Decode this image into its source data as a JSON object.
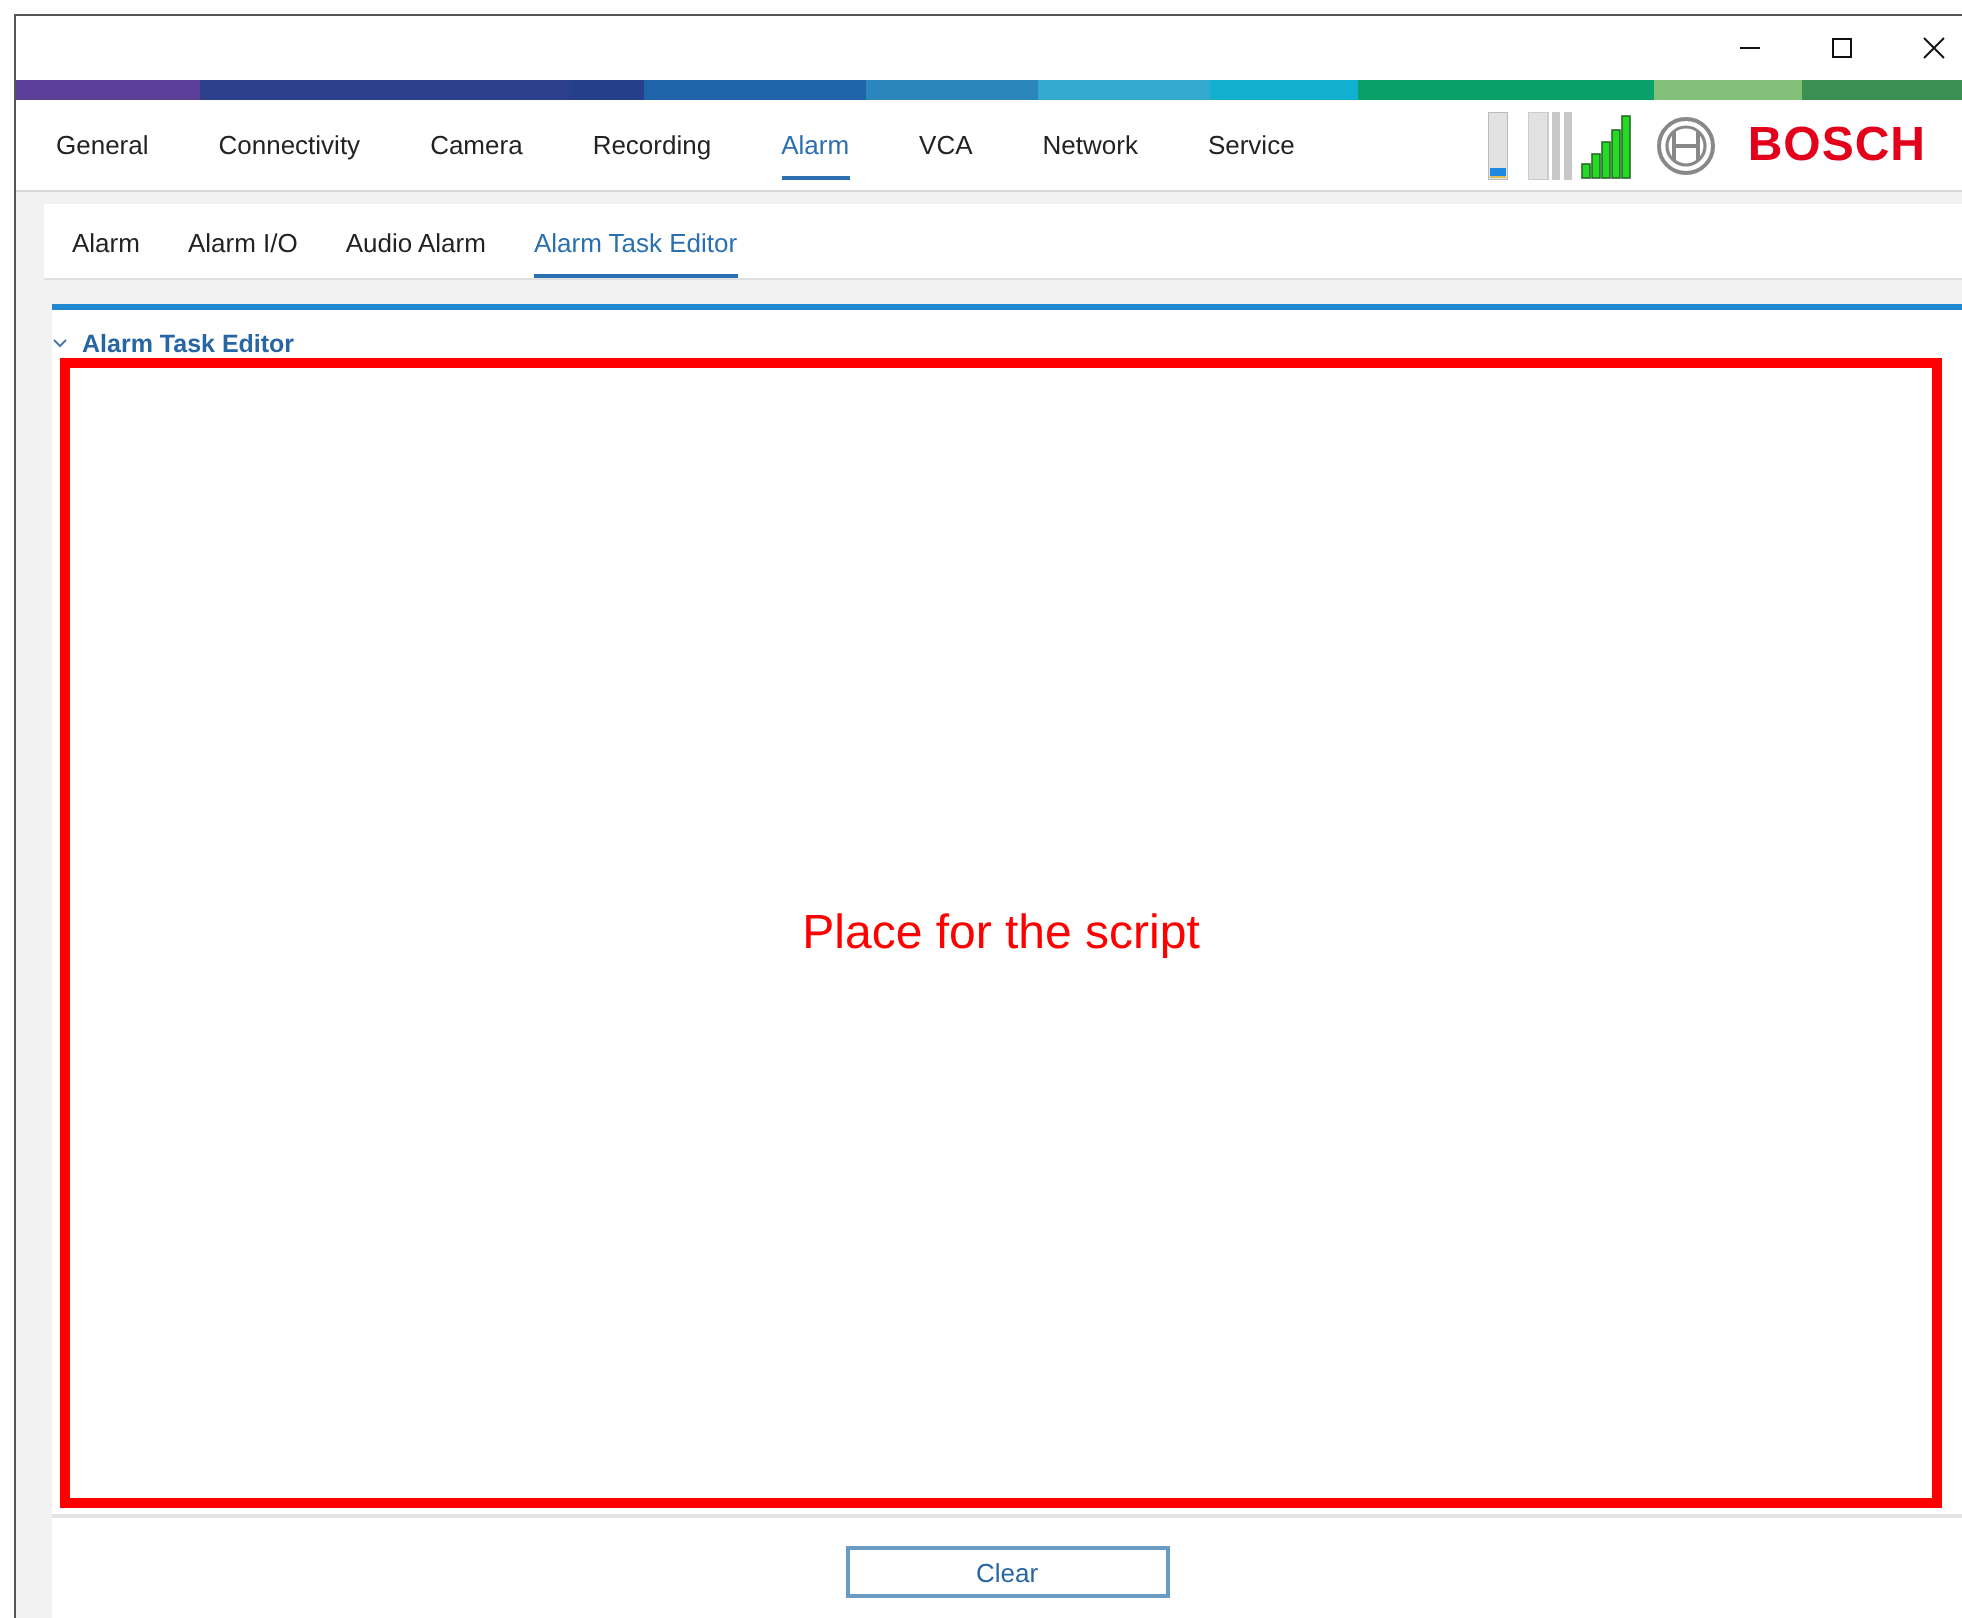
{
  "main_tabs": [
    {
      "label": "General",
      "selected": false
    },
    {
      "label": "Connectivity",
      "selected": false
    },
    {
      "label": "Camera",
      "selected": false
    },
    {
      "label": "Recording",
      "selected": false
    },
    {
      "label": "Alarm",
      "selected": true
    },
    {
      "label": "VCA",
      "selected": false
    },
    {
      "label": "Network",
      "selected": false
    },
    {
      "label": "Service",
      "selected": false
    }
  ],
  "brand": "BOSCH",
  "sub_tabs": [
    {
      "label": "Alarm",
      "selected": false
    },
    {
      "label": "Alarm I/O",
      "selected": false
    },
    {
      "label": "Audio Alarm",
      "selected": false
    },
    {
      "label": "Alarm Task Editor",
      "selected": true
    }
  ],
  "section": {
    "title": "Alarm Task Editor",
    "expanded": true,
    "annotation": "Place for the script"
  },
  "buttons": [
    "Clear"
  ]
}
